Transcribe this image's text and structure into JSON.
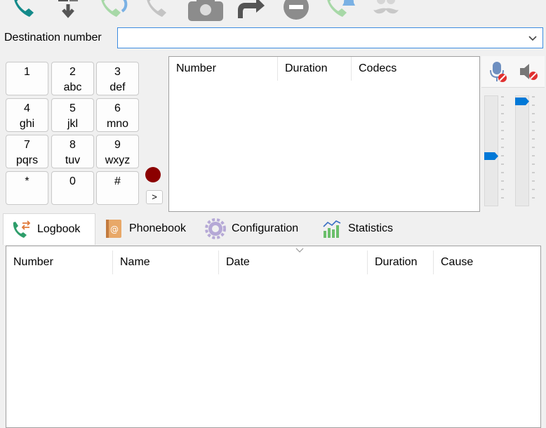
{
  "toolbar": {
    "icons": [
      "phone-call-icon",
      "transfer-down-icon",
      "phone-answer-icon",
      "phone-hangup-icon",
      "conference-icon",
      "forward-icon",
      "do-not-disturb-icon",
      "phone-bell-icon",
      "mustache-icon"
    ]
  },
  "destination": {
    "label": "Destination number",
    "value": ""
  },
  "keypad": [
    {
      "digit": "1",
      "letters": ""
    },
    {
      "digit": "2",
      "letters": "abc"
    },
    {
      "digit": "3",
      "letters": "def"
    },
    {
      "digit": "4",
      "letters": "ghi"
    },
    {
      "digit": "5",
      "letters": "jkl"
    },
    {
      "digit": "6",
      "letters": "mno"
    },
    {
      "digit": "7",
      "letters": "pqrs"
    },
    {
      "digit": "8",
      "letters": "tuv"
    },
    {
      "digit": "9",
      "letters": "wxyz"
    },
    {
      "digit": "*",
      "letters": ""
    },
    {
      "digit": "0",
      "letters": ""
    },
    {
      "digit": "#",
      "letters": ""
    }
  ],
  "more_label": ">",
  "calls_table": {
    "columns": [
      "Number",
      "Duration",
      "Codecs"
    ]
  },
  "volume": {
    "mic_level": 0.45,
    "speaker_level": 0.98
  },
  "tabs": [
    {
      "label": "Logbook",
      "active": true
    },
    {
      "label": "Phonebook",
      "active": false
    },
    {
      "label": "Configuration",
      "active": false
    },
    {
      "label": "Statistics",
      "active": false
    }
  ],
  "logbook_table": {
    "columns": [
      "Number",
      "Name",
      "Date",
      "Duration",
      "Cause"
    ]
  },
  "colors": {
    "accent": "#0078d7",
    "record": "#8b0000",
    "phone_green": "#2e9e6b"
  }
}
